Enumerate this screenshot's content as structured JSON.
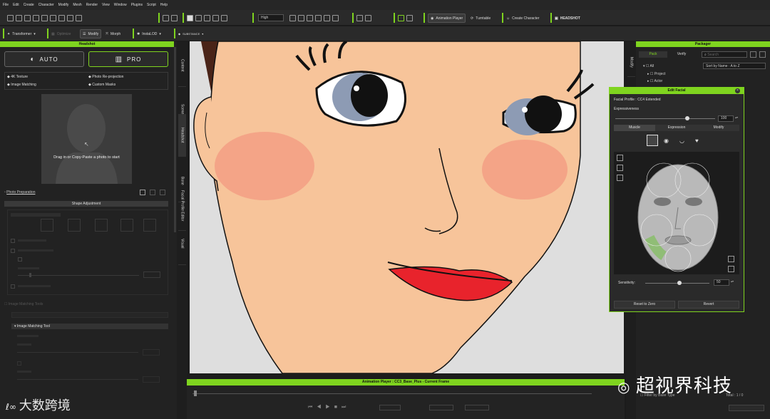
{
  "menu": [
    "File",
    "Edit",
    "Create",
    "Character",
    "Modify",
    "Mesh",
    "Render",
    "View",
    "Window",
    "Plugins",
    "Script",
    "Help"
  ],
  "toolbar1": {
    "quality": "High",
    "animation_player": "Animation Player",
    "turntable": "Turntable",
    "create_character": "Create Character",
    "headshot": "HEADSHOT"
  },
  "toolbar2": {
    "transformer": "Transformer",
    "optimize": "Optimize",
    "modify": "Modify",
    "morph": "Morph",
    "instalod": "InstaLOD",
    "substance": "SUBSTANCE"
  },
  "left_panel": {
    "title": "Headshot",
    "auto_label": "AUTO",
    "pro_label": "PRO",
    "features": [
      "4K Texture",
      "Photo Re-projection",
      "Image Matching",
      "Custom Masks"
    ],
    "drop_text": "Drag in or Copy-Paste a photo to start",
    "photo_prep": "Photo Preparation",
    "shape_adjustment": "Shape Adjustment",
    "image_matching_tools": "Image Matching Tools",
    "image_matching_tool": "Image Matching Tool"
  },
  "vtabs": [
    "Content",
    "Scene",
    "Headshot",
    "Bone",
    "Facial Profile Editor",
    "Visual"
  ],
  "anim_player": {
    "title": "Animation Player : CC3_Base_Plus - Current Frame"
  },
  "right_strip": [
    "Modify"
  ],
  "packager": {
    "title": "Packager",
    "tabs": [
      "Pack",
      "Verify"
    ],
    "search_placeholder": "Search",
    "sort": "Sort by Name : A to Z",
    "tree": [
      "All",
      "Project",
      "Actor"
    ],
    "filter": "Filter by Base Type",
    "total": "Total : 1 / 0"
  },
  "edit_facial": {
    "title": "Edit Facial",
    "profile": "Facial Profile : CC4 Extended",
    "expressiveness_label": "Expressiveness",
    "expressiveness_value": "100",
    "expressiveness_level": 1.0,
    "tabs": [
      "Muscle",
      "Expression",
      "Modify"
    ],
    "sensitivity_label": "Sensitivity:",
    "sensitivity_value": "50",
    "sensitivity_level": 0.5,
    "reset_label": "Reset to Zero",
    "revert_label": "Revert"
  },
  "watermark": "超视界科技",
  "logo": "大数跨境",
  "colors": {
    "accent": "#7fd41f",
    "skin": "#f7c49a",
    "lip": "#e8232c",
    "panel": "#222222"
  }
}
